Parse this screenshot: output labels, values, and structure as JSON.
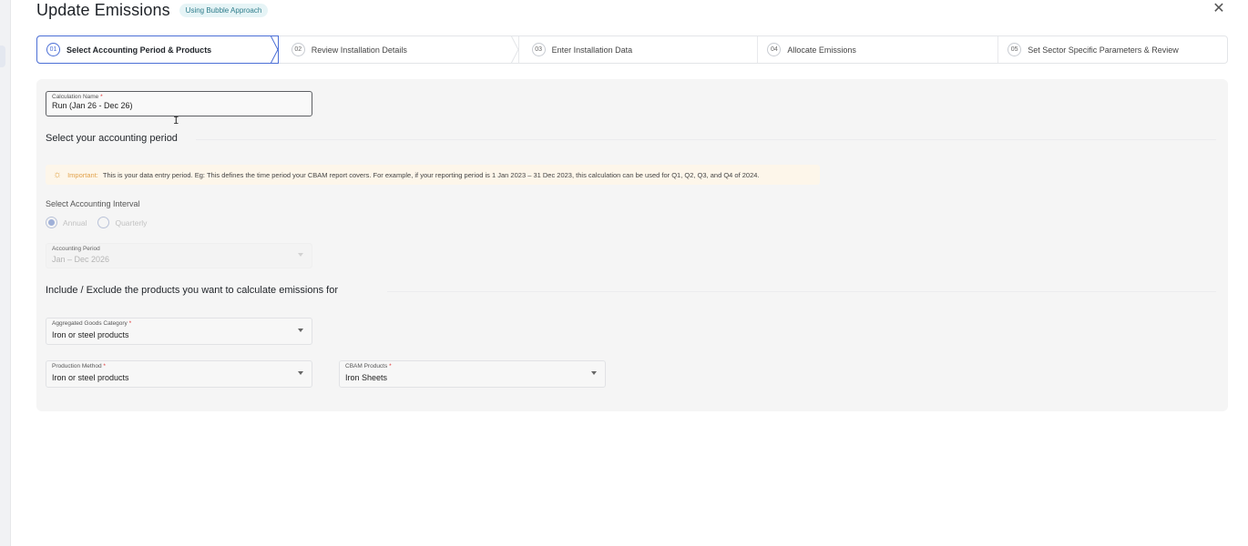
{
  "header": {
    "title": "Update Emissions",
    "badge": "Using Bubble Approach"
  },
  "steps": [
    {
      "num": "01",
      "label": "Select Accounting Period & Products"
    },
    {
      "num": "02",
      "label": "Review Installation Details"
    },
    {
      "num": "03",
      "label": "Enter Installation Data"
    },
    {
      "num": "04",
      "label": "Allocate Emissions"
    },
    {
      "num": "05",
      "label": "Set Sector Specific Parameters & Review"
    }
  ],
  "form": {
    "calc_name_label": "Calculation Name",
    "calc_name_value": "Run (Jan 26 - Dec 26)",
    "accounting_heading": "Select your accounting period",
    "important_label": "Important:",
    "important_text": "This is your data entry period. Eg: This defines the time period your CBAM report covers. For example, if your reporting period is 1 Jan 2023 – 31 Dec 2023, this calculation can be used for Q1, Q2, Q3, and Q4 of 2024.",
    "interval_label": "Select Accounting Interval",
    "interval_options": [
      "Annual",
      "Quarterly"
    ],
    "period_label": "Accounting Period",
    "period_value": "Jan – Dec 2026",
    "products_heading": "Include / Exclude the products you want to calculate emissions for",
    "agg_label": "Aggregated Goods Category",
    "agg_value": "Iron or steel products",
    "method_label": "Production Method",
    "method_value": "Iron or steel products",
    "cbam_label": "CBAM Products",
    "cbam_value": "Iron Sheets",
    "required_mark": "*"
  },
  "icons": {
    "close": "close-icon",
    "important": "sun-icon",
    "text_cursor": "text-cursor-icon"
  },
  "colors": {
    "accent": "#4c6fd6",
    "badge_text": "#2f7d8c",
    "badge_bg": "#e6f4f6",
    "important_bg": "#fdf6ea",
    "important_label": "#e2a24a"
  }
}
